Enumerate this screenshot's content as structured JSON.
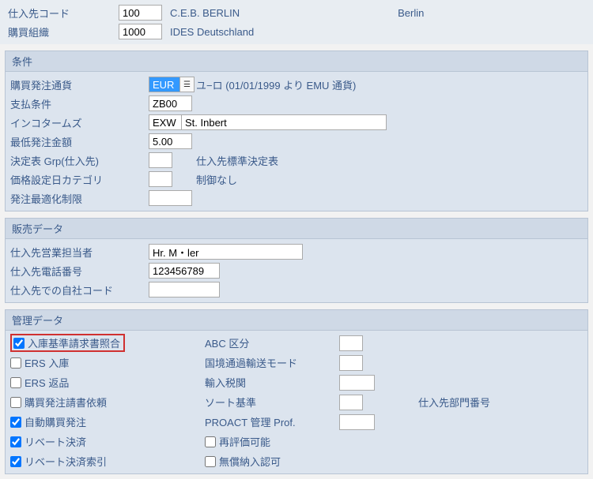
{
  "header": {
    "vendor_code_label": "仕入先コード",
    "vendor_code": "100",
    "vendor_name": "C.E.B. BERLIN",
    "vendor_city": "Berlin",
    "purch_org_label": "購買組織",
    "purch_org": "1000",
    "purch_org_desc": "IDES Deutschland"
  },
  "conditions": {
    "title": "条件",
    "currency_label": "購買発注通貨",
    "currency": "EUR",
    "currency_desc": "ユ−ロ (01/01/1999 より EMU 通貨)",
    "payterms_label": "支払条件",
    "payterms": "ZB00",
    "incoterms_label": "インコタームズ",
    "incoterms1": "EXW",
    "incoterms2": "St. Inbert",
    "minorder_label": "最低発注金額",
    "minorder": "5.00",
    "schema_label": "決定表 Grp(仕入先)",
    "schema": "",
    "schema_desc": "仕入先標準決定表",
    "pricedate_label": "価格設定日カテゴリ",
    "pricedate": "",
    "pricedate_desc": "制御なし",
    "orderopt_label": "発注最適化制限",
    "orderopt": ""
  },
  "sales": {
    "title": "販売データ",
    "salesperson_label": "仕入先営業担当者",
    "salesperson": "Hr. M・ler",
    "phone_label": "仕入先電話番号",
    "phone": "123456789",
    "owncode_label": "仕入先での自社コード",
    "owncode": ""
  },
  "mgmt": {
    "title": "管理データ",
    "gr_iv_label": "入庫基準請求書照合",
    "ers_in_label": "ERS 入庫",
    "ers_ret_label": "ERS 返品",
    "poreq_label": "購買発注請書依頼",
    "autopo_label": "自動購買発注",
    "rebate_label": "リベート決済",
    "rebateidx_label": "リベート決済索引",
    "abc_label": "ABC 区分",
    "transport_label": "国境通過輸送モード",
    "customs_label": "輸入税関",
    "sortkey_label": "ソート基準",
    "subrange_label": "仕入先部門番号",
    "proact_label": "PROACT 管理 Prof.",
    "reval_label": "再評価可能",
    "free_label": "無償納入認可"
  }
}
